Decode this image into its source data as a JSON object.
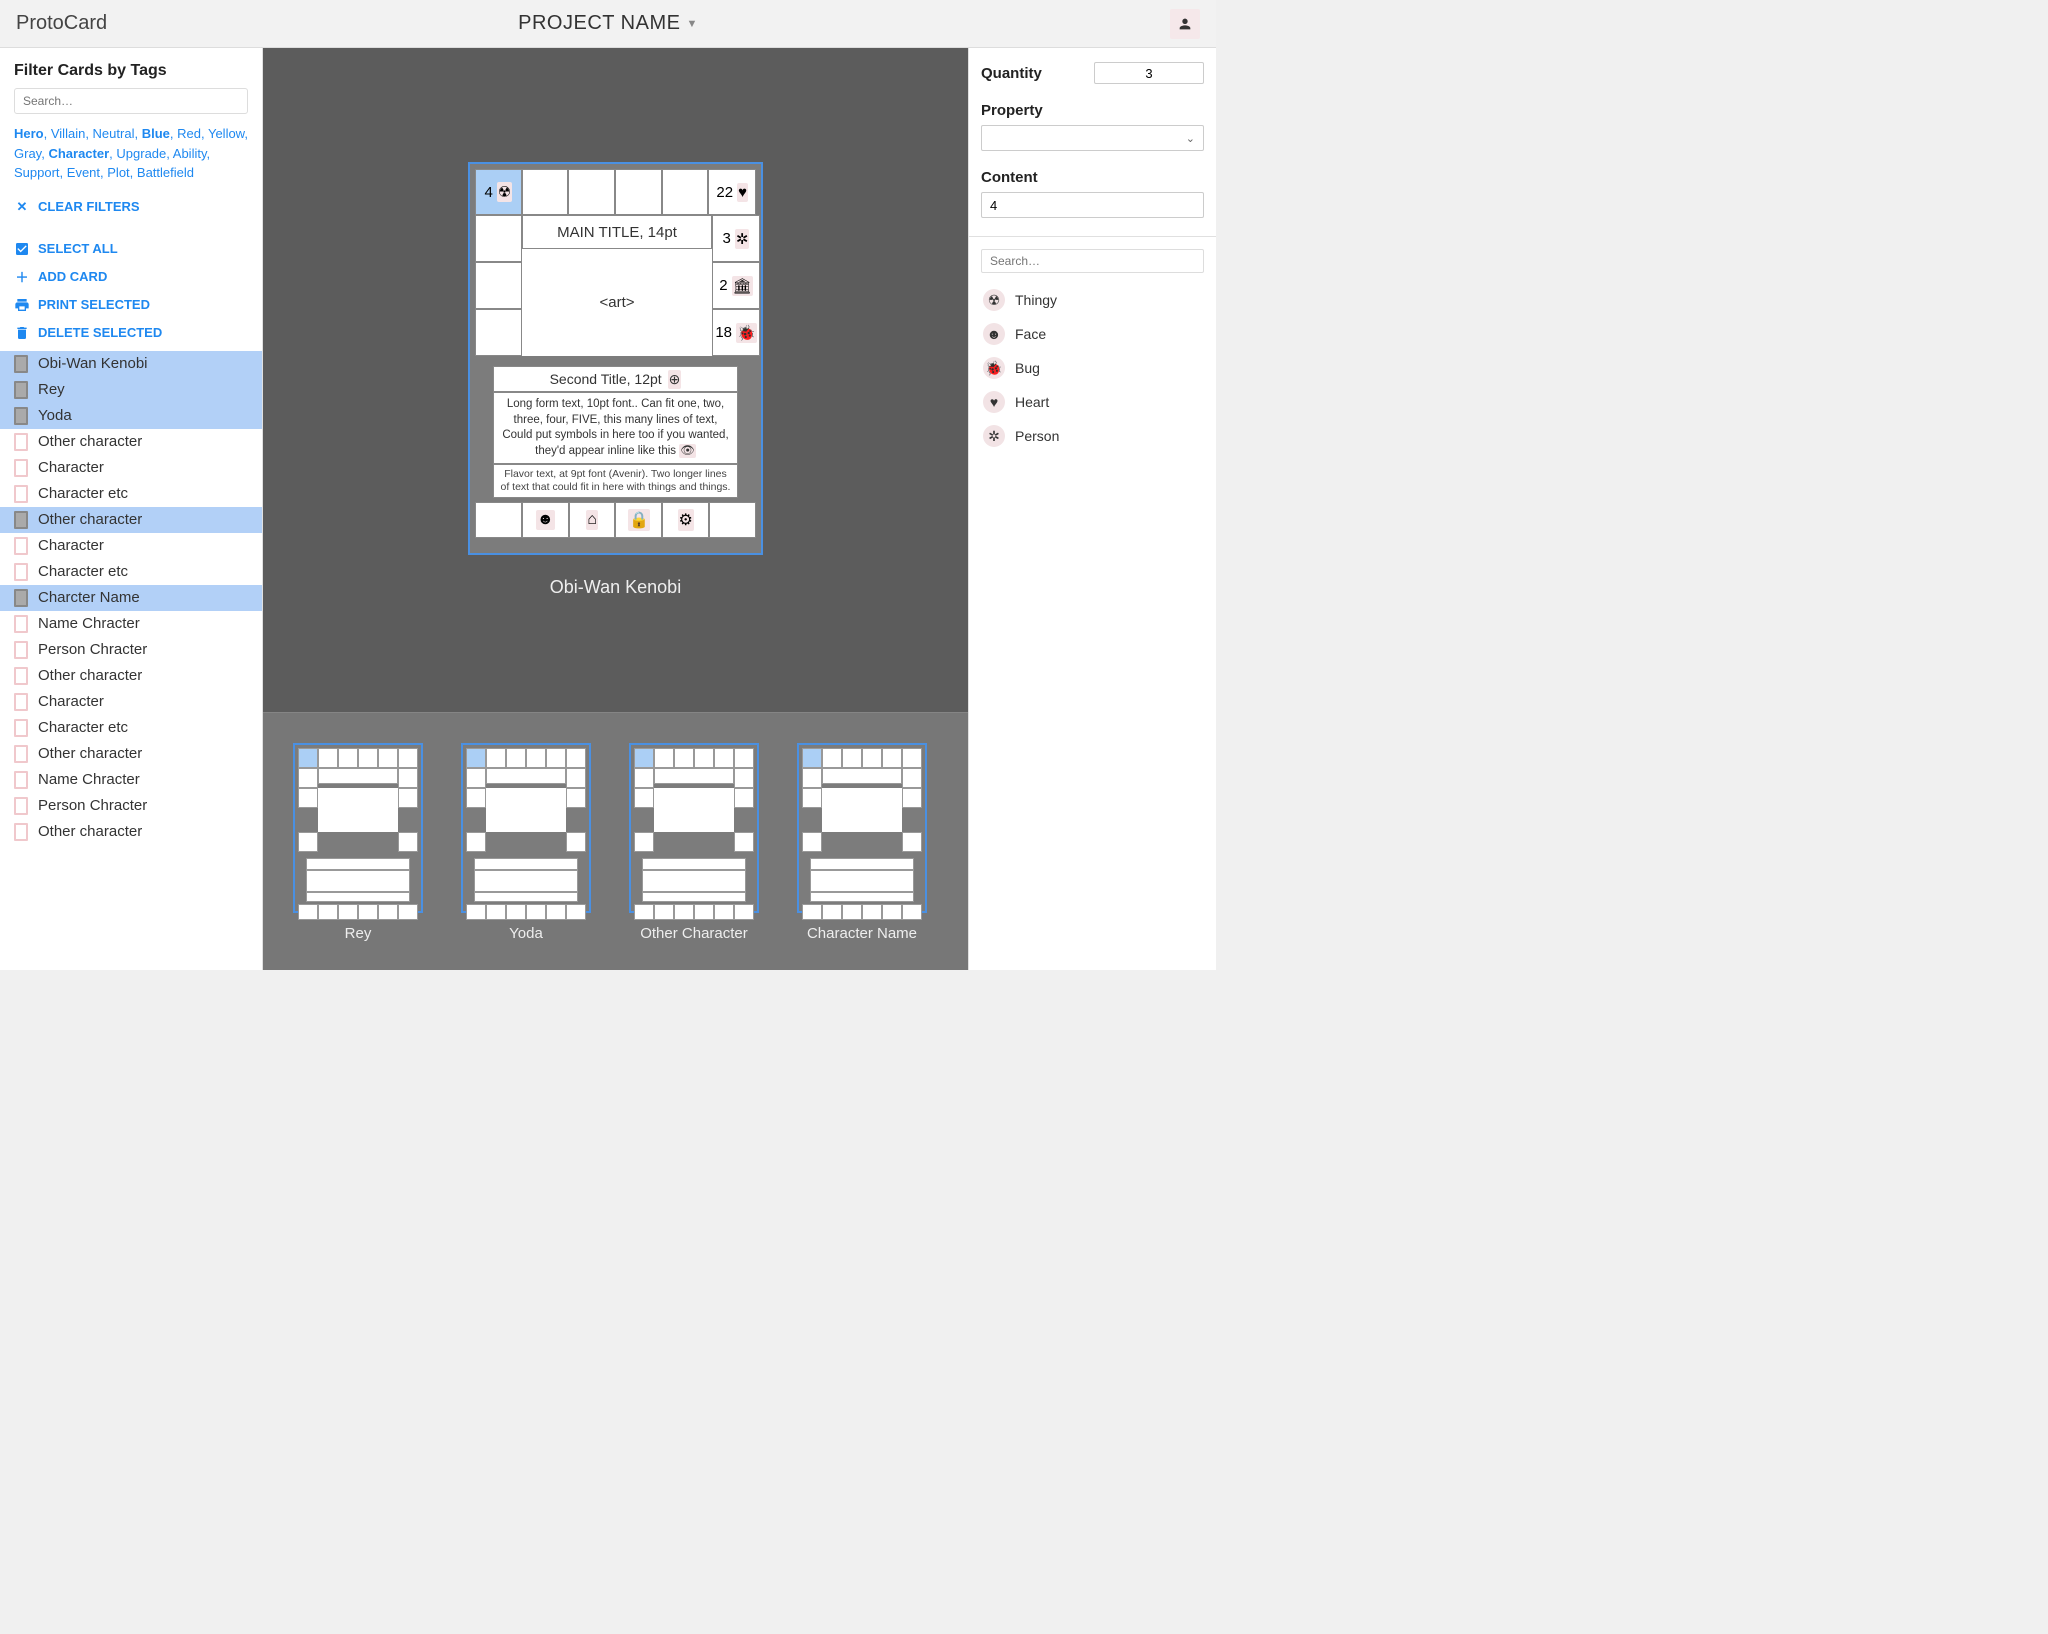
{
  "header": {
    "app_title": "ProtoCard",
    "project_name": "PROJECT NAME"
  },
  "left": {
    "filter_title": "Filter Cards by Tags",
    "search_placeholder": "Search…",
    "tags": [
      {
        "label": "Hero",
        "bold": true
      },
      {
        "label": ", "
      },
      {
        "label": "Villain"
      },
      {
        "label": ", "
      },
      {
        "label": "Neutral"
      },
      {
        "label": ", "
      },
      {
        "label": "Blue",
        "bold": true
      },
      {
        "label": ", "
      },
      {
        "label": "Red"
      },
      {
        "label": ", "
      },
      {
        "label": "Yellow"
      },
      {
        "label": ", "
      },
      {
        "label": "Gray"
      },
      {
        "label": ", "
      },
      {
        "label": "Character",
        "bold": true
      },
      {
        "label": ", "
      },
      {
        "label": "Upgrade"
      },
      {
        "label": ", "
      },
      {
        "label": "Ability"
      },
      {
        "label": ", "
      },
      {
        "label": "Support"
      },
      {
        "label": ", "
      },
      {
        "label": "Event"
      },
      {
        "label": ", "
      },
      {
        "label": "Plot"
      },
      {
        "label": ", "
      },
      {
        "label": "Battlefield"
      }
    ],
    "clear_filters": "CLEAR FILTERS",
    "select_all": "SELECT ALL",
    "add_card": "ADD CARD",
    "print_selected": "PRINT SELECTED",
    "delete_selected": "DELETE SELECTED",
    "cards": [
      {
        "name": "Obi-Wan Kenobi",
        "selected": true
      },
      {
        "name": "Rey",
        "selected": true
      },
      {
        "name": "Yoda",
        "selected": true
      },
      {
        "name": "Other character",
        "selected": false
      },
      {
        "name": "Character",
        "selected": false
      },
      {
        "name": "Character etc",
        "selected": false
      },
      {
        "name": "Other character",
        "selected": true
      },
      {
        "name": "Character",
        "selected": false
      },
      {
        "name": "Character etc",
        "selected": false
      },
      {
        "name": "Charcter Name",
        "selected": true
      },
      {
        "name": "Name Chracter",
        "selected": false
      },
      {
        "name": "Person Chracter",
        "selected": false
      },
      {
        "name": "Other character",
        "selected": false
      },
      {
        "name": "Character",
        "selected": false
      },
      {
        "name": "Character etc",
        "selected": false
      },
      {
        "name": "Other character",
        "selected": false
      },
      {
        "name": "Name Chracter",
        "selected": false
      },
      {
        "name": "Person Chracter",
        "selected": false
      },
      {
        "name": "Other character",
        "selected": false
      }
    ]
  },
  "center": {
    "card": {
      "top_left_value": "4",
      "top_right_value": "22",
      "main_title": "MAIN TITLE, 14pt",
      "right_vals": [
        "3",
        "2",
        "18"
      ],
      "art_placeholder": "<art>",
      "second_title": "Second Title, 12pt",
      "long_text": "Long form text, 10pt font.. Can fit one, two, three, four, FIVE, this many lines of text, Could put symbols in here too if you wanted, they'd appear inline like this",
      "flavor_text": "Flavor text, at 9pt font (Avenir). Two longer lines of text that could fit in here with things and things.",
      "name": "Obi-Wan Kenobi"
    },
    "thumbs": [
      {
        "name": "Rey"
      },
      {
        "name": "Yoda"
      },
      {
        "name": "Other Character"
      },
      {
        "name": "Character Name"
      }
    ]
  },
  "right": {
    "quantity_label": "Quantity",
    "quantity_value": "3",
    "property_label": "Property",
    "content_label": "Content",
    "content_value": "4",
    "symbol_search_placeholder": "Search…",
    "symbols": [
      {
        "name": "Thingy",
        "icon": "radiation"
      },
      {
        "name": "Face",
        "icon": "face"
      },
      {
        "name": "Bug",
        "icon": "bug"
      },
      {
        "name": "Heart",
        "icon": "heart"
      },
      {
        "name": "Person",
        "icon": "person"
      }
    ]
  }
}
